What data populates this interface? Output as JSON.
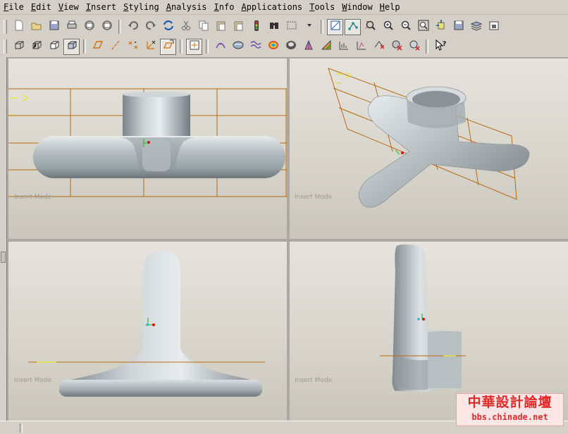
{
  "menu": [
    "File",
    "Edit",
    "View",
    "Insert",
    "Styling",
    "Analysis",
    "Info",
    "Applications",
    "Tools",
    "Window",
    "Help"
  ],
  "toolbar_row1": [
    {
      "name": "new-icon"
    },
    {
      "name": "open-icon"
    },
    {
      "name": "save-icon"
    },
    {
      "name": "print-icon"
    },
    {
      "name": "send-mail-icon"
    },
    {
      "name": "mail-attach-icon"
    },
    {
      "sep": true
    },
    {
      "name": "undo-icon"
    },
    {
      "name": "redo-icon"
    },
    {
      "name": "regenerate-icon"
    },
    {
      "name": "cut-icon"
    },
    {
      "name": "copy-icon"
    },
    {
      "name": "paste-icon"
    },
    {
      "name": "paste-special-icon"
    },
    {
      "name": "regen-traffic-light-icon"
    },
    {
      "name": "find-binoculars-icon"
    },
    {
      "name": "selection-box-icon"
    },
    {
      "name": "selection-dropdown-icon"
    },
    {
      "sep": true
    },
    {
      "name": "datum-display-icon",
      "active": true
    },
    {
      "name": "datum-axes-icon",
      "active": true
    },
    {
      "name": "refit-icon"
    },
    {
      "name": "zoom-in-icon"
    },
    {
      "name": "zoom-out-icon"
    },
    {
      "name": "zoom-fit-icon"
    },
    {
      "name": "reorient-icon"
    },
    {
      "name": "saved-views-icon"
    },
    {
      "name": "layers-icon"
    },
    {
      "name": "view-manager-icon"
    }
  ],
  "toolbar_row2": [
    {
      "name": "wireframe-icon"
    },
    {
      "name": "hidden-line-icon"
    },
    {
      "name": "no-hidden-icon"
    },
    {
      "name": "shading-icon",
      "active": true
    },
    {
      "sep": true
    },
    {
      "name": "datum-plane-icon"
    },
    {
      "name": "datum-axis-icon"
    },
    {
      "name": "datum-point-icon"
    },
    {
      "name": "coordinate-system-icon"
    },
    {
      "name": "active-plane-icon",
      "active": true
    },
    {
      "sep": true
    },
    {
      "name": "internal-plane-icon",
      "active": true
    },
    {
      "sep": true
    },
    {
      "name": "curvature-icon"
    },
    {
      "name": "section-icon"
    },
    {
      "name": "offset-icon"
    },
    {
      "name": "deviation-icon"
    },
    {
      "name": "gaussian-icon"
    },
    {
      "name": "draft-icon"
    },
    {
      "name": "slope-icon"
    },
    {
      "name": "dihedral-icon"
    },
    {
      "name": "reflection-icon"
    },
    {
      "name": "shade-analysis-icon"
    },
    {
      "name": "delete-analysis-icon"
    },
    {
      "name": "hide-analysis-icon"
    },
    {
      "sep": true
    },
    {
      "name": "context-help-icon"
    }
  ],
  "viewports": [
    {
      "name": "viewport-front",
      "mode": "Insert Mode"
    },
    {
      "name": "viewport-isometric",
      "mode": "Insert Mode"
    },
    {
      "name": "viewport-side",
      "mode": "Insert Mode"
    },
    {
      "name": "viewport-right",
      "mode": "Insert Mode"
    }
  ],
  "colors": {
    "datum": "#b86a10",
    "ui": "#d4d0c8",
    "body": "#9aa3a8",
    "highlight": "#e9ecec"
  },
  "watermark": {
    "line1": "中華設計論壇",
    "line2": "bbs.chinade.net"
  }
}
